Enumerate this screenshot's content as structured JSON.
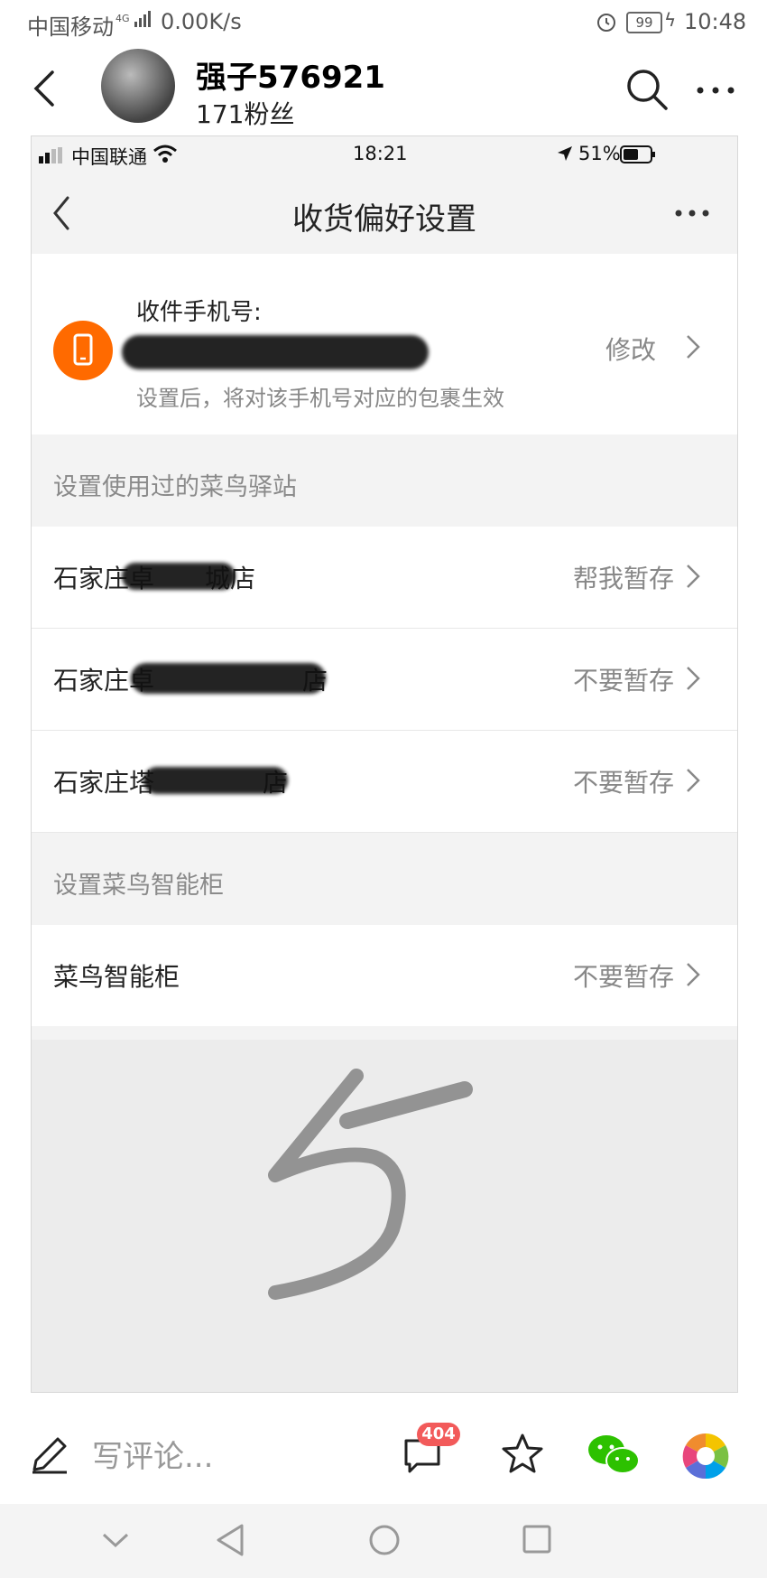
{
  "status_bar": {
    "carrier": "中国移动",
    "network": "4G",
    "speed": "0.00K/s",
    "battery": "99",
    "time": "10:48"
  },
  "header": {
    "username": "强子576921",
    "followers": "171粉丝"
  },
  "embedded": {
    "status": {
      "carrier": "中国联通",
      "time": "18:21",
      "battery": "51%"
    },
    "title": "收货偏好设置",
    "phone_card": {
      "label": "收件手机号:",
      "note": "设置后，将对该手机号对应的包裹生效",
      "action": "修改"
    },
    "section_stations": "设置使用过的菜鸟驿站",
    "stations": [
      {
        "name": "石家庄卓",
        "suffix": "城店",
        "action": "帮我暂存"
      },
      {
        "name": "石家庄卓",
        "suffix": "店",
        "action": "不要暂存"
      },
      {
        "name": "石家庄塔",
        "suffix": "店",
        "action": "不要暂存"
      }
    ],
    "section_lockers": "设置菜鸟智能柜",
    "lockers": [
      {
        "name": "菜鸟智能柜",
        "action": "不要暂存"
      }
    ]
  },
  "bottom_bar": {
    "comment_placeholder": "写评论...",
    "comment_count": "404"
  },
  "colors": {
    "accent_orange": "#ff6a00",
    "badge_red": "#f25a5a",
    "wechat_green": "#2dc100"
  }
}
